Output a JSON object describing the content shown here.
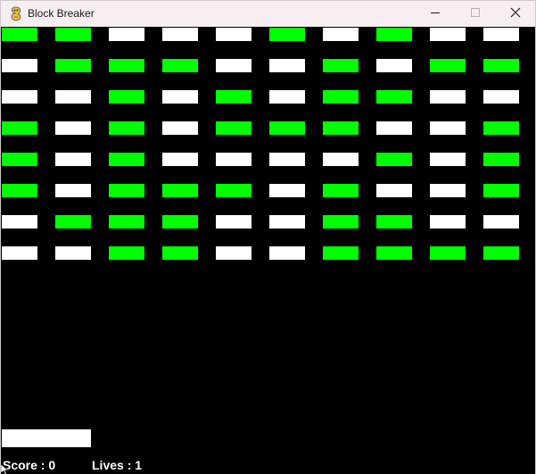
{
  "window": {
    "title": "Block Breaker",
    "app_icon": "pygame-snake-icon",
    "controls": [
      "minimize-icon",
      "maximize-icon",
      "close-icon"
    ]
  },
  "colors": {
    "background": "#000000",
    "brick_green": "#00ff00",
    "brick_white": "#ffffff",
    "paddle": "#ffffff",
    "hud_text": "#ffffff"
  },
  "bricks": {
    "grid": [
      [
        "G",
        "G",
        "W",
        "W",
        "W",
        "G",
        "W",
        "G",
        "W",
        "W"
      ],
      [
        "W",
        "G",
        "G",
        "G",
        "W",
        "W",
        "G",
        "W",
        "G",
        "G"
      ],
      [
        "W",
        "W",
        "G",
        "W",
        "G",
        "W",
        "G",
        "G",
        "W",
        "W"
      ],
      [
        "G",
        "W",
        "G",
        "W",
        "G",
        "G",
        "G",
        "W",
        "W",
        "G"
      ],
      [
        "G",
        "W",
        "G",
        "W",
        "W",
        "W",
        "W",
        "G",
        "W",
        "G"
      ],
      [
        "G",
        "W",
        "G",
        "G",
        "G",
        "W",
        "G",
        "W",
        "W",
        "G"
      ],
      [
        "W",
        "G",
        "G",
        "G",
        "W",
        "W",
        "G",
        "G",
        "W",
        "W"
      ],
      [
        "W",
        "W",
        "G",
        "G",
        "W",
        "W",
        "G",
        "G",
        "G",
        "G"
      ]
    ]
  },
  "hud": {
    "score_label": "Score : 0",
    "lives_label": "Lives : 1"
  }
}
